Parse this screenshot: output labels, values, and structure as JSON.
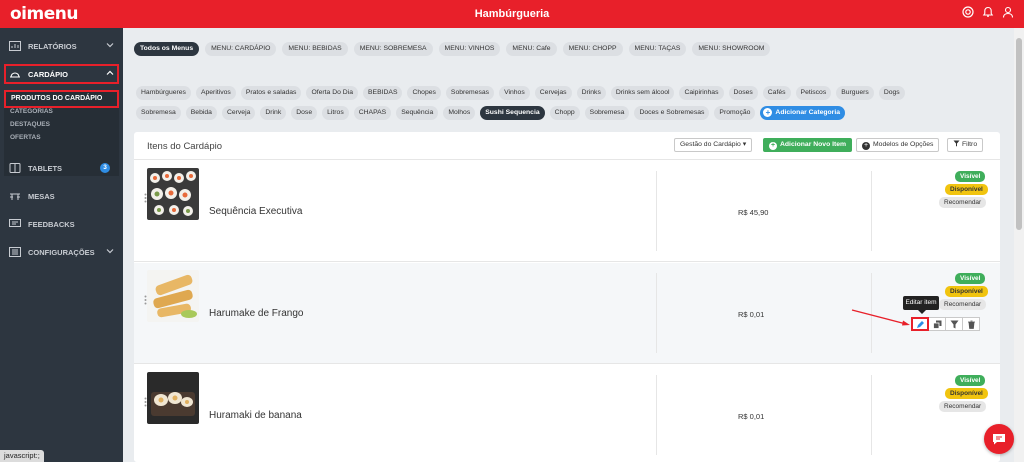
{
  "app": {
    "logo": "oimenu",
    "title": "Hambúrgueria"
  },
  "colors": {
    "brand": "#e8202a",
    "sidebar": "#2d3640",
    "success": "#3fae5b",
    "warning": "#f1c40f",
    "info": "#2f8de4"
  },
  "header": {
    "icons": [
      "support-icon",
      "bell-icon",
      "user-icon"
    ]
  },
  "sidebar": {
    "reports": "RELATÓRIOS",
    "menu": "CARDÁPIO",
    "sub_items": [
      "PRODUTOS DO CARDÁPIO",
      "CATEGORIAS",
      "DESTAQUES",
      "OFERTAS"
    ],
    "tablets": "TABLETS",
    "tablets_count": "3",
    "tables": "MESAS",
    "feedbacks": "FEEDBACKS",
    "settings": "CONFIGURAÇÕES"
  },
  "menu_tabs": [
    "Todos os Menus",
    "MENU: CARDÁPIO",
    "MENU: BEBIDAS",
    "MENU: SOBREMESA",
    "MENU: VINHOS",
    "MENU: Cafe",
    "MENU: CHOPP",
    "MENU: TAÇAS",
    "MENU: SHOWROOM"
  ],
  "categories": {
    "row1": [
      "Hambúrgueres",
      "Aperitivos",
      "Pratos e saladas",
      "Oferta Do Dia",
      "BEBIDAS",
      "Chopes",
      "Sobremesas",
      "Vinhos",
      "Cervejas",
      "Drinks",
      "Drinks sem álcool",
      "Caipirinhas",
      "Doses",
      "Cafés",
      "Petiscos",
      "Burguers",
      "Dogs"
    ],
    "row2": [
      "Sobremesa",
      "Bebida",
      "Cerveja",
      "Drink",
      "Dose",
      "Litros",
      "CHAPAS",
      "Sequência",
      "Molhos",
      "Sushi Sequencia",
      "Chopp",
      "Sobremesa",
      "Doces e Sobremesas",
      "Promoção"
    ],
    "add_label": "Adicionar Categoria"
  },
  "items_panel": {
    "title": "Itens do Cardápio",
    "manage_label": "Gestão do Cardápio ▾",
    "add_item_label": "Adicionar Novo Item",
    "options_label": "Modelos de Opções",
    "filter_label": "Filtro"
  },
  "items": [
    {
      "name": "Sequência Executiva",
      "price": "R$ 45,90",
      "visible": "Visível",
      "available": "Disponível",
      "recommend": "Recomendar"
    },
    {
      "name": "Harumake de Frango",
      "price": "R$ 0,01",
      "visible": "Visível",
      "available": "Disponível",
      "recommend": "Recomendar"
    },
    {
      "name": "Huramaki de banana",
      "price": "R$ 0,01",
      "visible": "Visível",
      "available": "Disponível",
      "recommend": "Recomendar"
    }
  ],
  "tooltip": "Editar item",
  "statusbar": "javascript:;"
}
